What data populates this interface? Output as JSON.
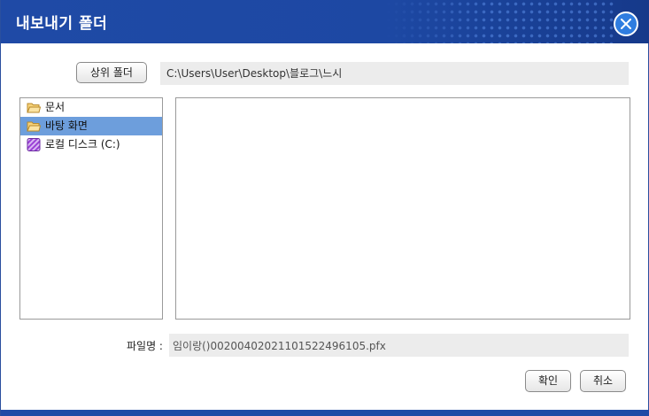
{
  "dialog": {
    "title": "내보내기 폴더",
    "close_icon": "close-icon"
  },
  "toolbar": {
    "up_folder_label": "상위 폴더",
    "path": "C:\\Users\\User\\Desktop\\블로그\\느시"
  },
  "tree": {
    "items": [
      {
        "label": "문서",
        "icon": "folder-icon",
        "selected": false
      },
      {
        "label": "바탕 화면",
        "icon": "folder-icon",
        "selected": true
      },
      {
        "label": "로컬 디스크 (C:)",
        "icon": "drive-icon",
        "selected": false
      }
    ]
  },
  "filename": {
    "label": "파일명 :",
    "value": "임이랑()0020040202110152249​6105.pfx"
  },
  "buttons": {
    "ok": "확인",
    "cancel": "취소"
  },
  "colors": {
    "titlebar": "#1f4aa6",
    "selection": "#6d9edc",
    "field_bg": "#ececec"
  }
}
